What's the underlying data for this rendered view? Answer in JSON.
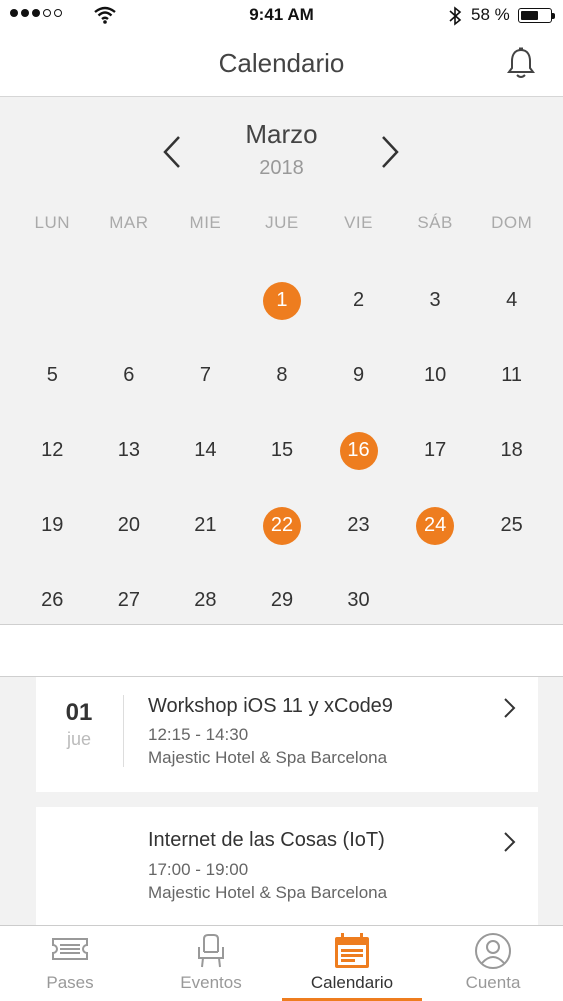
{
  "status_bar": {
    "time": "9:41 AM",
    "battery_text": "58 %",
    "battery_level": 0.58
  },
  "header": {
    "title": "Calendario",
    "action_icon": "bell-icon"
  },
  "calendar": {
    "month": "Marzo",
    "year": "2018",
    "weekdays": [
      "LUN",
      "MAR",
      "MIE",
      "JUE",
      "VIE",
      "SÁB",
      "DOM"
    ],
    "leading_blank_days": 3,
    "days": [
      "1",
      "2",
      "3",
      "4",
      "5",
      "6",
      "7",
      "8",
      "9",
      "10",
      "11",
      "12",
      "13",
      "14",
      "15",
      "16",
      "17",
      "18",
      "19",
      "20",
      "21",
      "22",
      "23",
      "24",
      "25",
      "26",
      "27",
      "28",
      "29",
      "30"
    ],
    "event_days": [
      "1",
      "16",
      "22",
      "24"
    ],
    "accent_color": "#ee7d1f"
  },
  "events": [
    {
      "day": "01",
      "weekday": "jue",
      "title": "Workshop iOS 11 y xCode9",
      "time": "12:15 - 14:30",
      "place": "Majestic Hotel & Spa Barcelona"
    },
    {
      "title": "Internet de las Cosas (IoT)",
      "time": "17:00 - 19:00",
      "place": "Majestic Hotel & Spa Barcelona"
    }
  ],
  "tabs": [
    {
      "label": "Pases",
      "icon": "ticket-icon",
      "active": false
    },
    {
      "label": "Eventos",
      "icon": "chair-icon",
      "active": false
    },
    {
      "label": "Calendario",
      "icon": "calendar-icon",
      "active": true
    },
    {
      "label": "Cuenta",
      "icon": "user-icon",
      "active": false
    }
  ]
}
